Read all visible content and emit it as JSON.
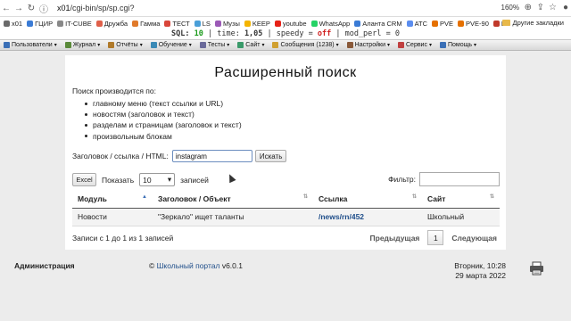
{
  "browser": {
    "url_host": "x01",
    "url_path": "/cgi-bin/sp/sp.cgi?",
    "zoom": "160%"
  },
  "bookmarks": [
    {
      "label": "x01",
      "color": "#6a6a6a"
    },
    {
      "label": "ГЦИР",
      "color": "#3a7bd5"
    },
    {
      "label": "IT-CUBE",
      "color": "#888888"
    },
    {
      "label": "Дружба",
      "color": "#e0604a"
    },
    {
      "label": "Гамма",
      "color": "#e07a2a"
    },
    {
      "label": "ТЕСТ",
      "color": "#d9463a"
    },
    {
      "label": "LS",
      "color": "#4a9fd8"
    },
    {
      "label": "Музы",
      "color": "#9b59b6"
    },
    {
      "label": "KEEP",
      "color": "#f4b400"
    },
    {
      "label": "youtube",
      "color": "#e62117"
    },
    {
      "label": "WhatsApp",
      "color": "#25d366"
    },
    {
      "label": "Аланта CRM",
      "color": "#3a7bd5"
    },
    {
      "label": "АТС",
      "color": "#5b8def"
    },
    {
      "label": "PVE",
      "color": "#e57000"
    },
    {
      "label": "PVE-90",
      "color": "#e57000"
    },
    {
      "label": "EX",
      "color": "#c0392b"
    }
  ],
  "other_bookmarks": "Другие закладки",
  "debug": {
    "sql_label": "SQL:",
    "sql_value": "10",
    "time_label": "time:",
    "time_value": "1,05",
    "speedy_label": "speedy =",
    "speedy_value": "off",
    "mod_perl": "mod_perl = 0"
  },
  "menu": [
    {
      "label": "Пользователи",
      "color": "#3a6fb6"
    },
    {
      "label": "Журнал",
      "color": "#5a8a3a"
    },
    {
      "label": "Отчёты",
      "color": "#b07a2a"
    },
    {
      "label": "Обучение",
      "color": "#3a8ab6"
    },
    {
      "label": "Тесты",
      "color": "#6a6a9a"
    },
    {
      "label": "Сайт",
      "color": "#3a9a6a"
    },
    {
      "label": "Сообщения (1238)",
      "color": "#d0a030"
    },
    {
      "label": "Настройки",
      "color": "#8a5a3a"
    },
    {
      "label": "Сервис",
      "color": "#c04040"
    },
    {
      "label": "Помощь",
      "color": "#3a6fb6"
    }
  ],
  "page": {
    "title": "Расширенный поиск",
    "intro": "Поиск производится по:",
    "bullets": [
      "главному меню (текст ссылки и URL)",
      "новостям (заголовок и текст)",
      "разделам и страницам (заголовок и текст)",
      "произвольным блокам"
    ],
    "search_label": "Заголовок / ссылка / HTML:",
    "search_value": "instagram",
    "search_button": "Искать"
  },
  "table_controls": {
    "excel": "Excel",
    "show_label": "Показать",
    "page_size": "10",
    "entries_label": "записей",
    "filter_label": "Фильтр:"
  },
  "table": {
    "columns": [
      "Модуль",
      "Заголовок / Объект",
      "Ссылка",
      "Сайт"
    ],
    "rows": [
      [
        "Новости",
        "\"Зеркало\" ищет таланты",
        "/news/rn/452",
        "Школьный"
      ]
    ]
  },
  "pager": {
    "info": "Записи с 1 до 1 из 1 записей",
    "prev": "Предыдущая",
    "current": "1",
    "next": "Следующая"
  },
  "footer": {
    "admin": "Администрация",
    "copyright": "©",
    "portal_link": "Школьный портал",
    "version": "v6.0.1",
    "weekday_time": "Вторник, 10:28",
    "date": "29 марта 2022"
  }
}
